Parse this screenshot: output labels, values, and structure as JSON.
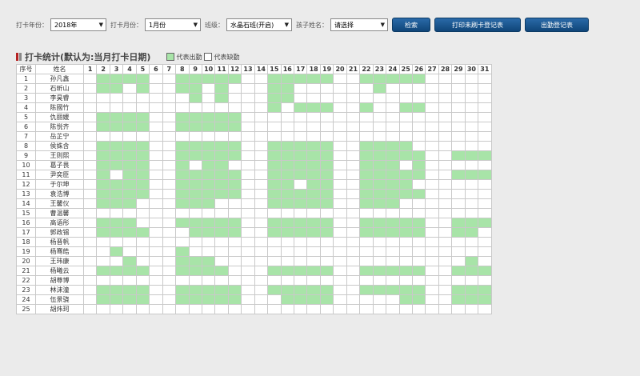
{
  "filters": {
    "year_label": "打卡年份：",
    "year_value": "2018年",
    "month_label": "打卡月份：",
    "month_value": "1月份",
    "class_label": "班级：",
    "class_value": "水晶石班(开启)",
    "child_label": "孩子姓名：",
    "child_value": "请选择"
  },
  "buttons": {
    "search": "检索",
    "print_unpunched": "打印未刷卡登记表",
    "attendance_sheet": "出勤登记表"
  },
  "section": {
    "title": "打卡统计(默认为:当月打卡日期)",
    "legend_present": "代表出勤",
    "legend_absent": "代表缺勤"
  },
  "colors": {
    "present": "#a8e4a8",
    "absent": "#ffffff",
    "button": "#1a5690",
    "title_mark": "#b52222"
  },
  "table": {
    "col_index": "序号",
    "col_name": "姓名",
    "days": [
      1,
      2,
      3,
      4,
      5,
      6,
      7,
      8,
      9,
      10,
      11,
      12,
      13,
      14,
      15,
      16,
      17,
      18,
      19,
      20,
      21,
      22,
      23,
      24,
      25,
      26,
      27,
      28,
      29,
      30,
      31
    ],
    "rows": [
      {
        "no": "1",
        "name": "孙凡鑫",
        "attend": [
          2,
          3,
          4,
          5,
          8,
          9,
          10,
          11,
          12,
          15,
          16,
          17,
          18,
          19,
          22,
          23,
          24,
          25,
          26
        ]
      },
      {
        "no": "2",
        "name": "石昕山",
        "attend": [
          2,
          3,
          5,
          8,
          9,
          11,
          15,
          16,
          23
        ]
      },
      {
        "no": "3",
        "name": "李昊睿",
        "attend": [
          9,
          11,
          15,
          16
        ]
      },
      {
        "no": "4",
        "name": "陈國竹",
        "attend": [
          15,
          17,
          18,
          19,
          22,
          25,
          26
        ]
      },
      {
        "no": "5",
        "name": "仇丽媛",
        "attend": [
          2,
          3,
          4,
          5,
          8,
          9,
          10,
          11,
          12
        ]
      },
      {
        "no": "6",
        "name": "陈悦齐",
        "attend": [
          2,
          3,
          4,
          5,
          8,
          9,
          10,
          11,
          12
        ]
      },
      {
        "no": "7",
        "name": "岳芷宁",
        "attend": []
      },
      {
        "no": "8",
        "name": "侯姝含",
        "attend": [
          2,
          3,
          4,
          5,
          8,
          9,
          10,
          11,
          12,
          15,
          16,
          17,
          18,
          19,
          22,
          23,
          24,
          25
        ]
      },
      {
        "no": "9",
        "name": "王则熙",
        "attend": [
          2,
          3,
          4,
          5,
          8,
          9,
          10,
          11,
          12,
          15,
          16,
          17,
          18,
          19,
          22,
          23,
          24,
          25,
          26,
          29,
          30,
          31
        ]
      },
      {
        "no": "10",
        "name": "葛子畏",
        "attend": [
          2,
          3,
          4,
          5,
          8,
          10,
          11,
          15,
          16,
          17,
          18,
          19,
          22,
          23,
          24,
          26
        ]
      },
      {
        "no": "11",
        "name": "尹奕臣",
        "attend": [
          2,
          4,
          5,
          8,
          9,
          10,
          11,
          12,
          15,
          16,
          17,
          18,
          19,
          22,
          23,
          24,
          25,
          26,
          29,
          30,
          31
        ]
      },
      {
        "no": "12",
        "name": "于尔坤",
        "attend": [
          2,
          3,
          4,
          5,
          8,
          9,
          10,
          11,
          12,
          15,
          16,
          18,
          19,
          22,
          23,
          24,
          25
        ]
      },
      {
        "no": "13",
        "name": "袁浩博",
        "attend": [
          2,
          3,
          4,
          5,
          8,
          9,
          10,
          11,
          12,
          15,
          16,
          17,
          18,
          19,
          22,
          23,
          24,
          25,
          26
        ]
      },
      {
        "no": "14",
        "name": "王馨仪",
        "attend": [
          2,
          3,
          4,
          8,
          9,
          10,
          15,
          16,
          17,
          18,
          19,
          22,
          23,
          24
        ]
      },
      {
        "no": "15",
        "name": "曹温馨",
        "attend": []
      },
      {
        "no": "16",
        "name": "高语彤",
        "attend": [
          2,
          3,
          4,
          8,
          9,
          10,
          11,
          12,
          15,
          16,
          17,
          18,
          19,
          22,
          23,
          24,
          25,
          26,
          29,
          30,
          31
        ]
      },
      {
        "no": "17",
        "name": "郭政锡",
        "attend": [
          2,
          3,
          4,
          5,
          9,
          10,
          11,
          12,
          15,
          16,
          17,
          18,
          19,
          22,
          23,
          24,
          25,
          26,
          29,
          30
        ]
      },
      {
        "no": "18",
        "name": "杨晋帆",
        "attend": []
      },
      {
        "no": "19",
        "name": "杨骞皓",
        "attend": [
          3,
          8
        ]
      },
      {
        "no": "20",
        "name": "王玮康",
        "attend": [
          4,
          8,
          9,
          10,
          30
        ]
      },
      {
        "no": "21",
        "name": "杨曦云",
        "attend": [
          2,
          3,
          4,
          5,
          8,
          9,
          10,
          11,
          15,
          16,
          17,
          18,
          19,
          22,
          23,
          24,
          25,
          26,
          29,
          30,
          31
        ]
      },
      {
        "no": "22",
        "name": "胡尊博",
        "attend": []
      },
      {
        "no": "23",
        "name": "林沫潼",
        "attend": [
          2,
          3,
          4,
          5,
          8,
          9,
          10,
          11,
          12,
          15,
          16,
          17,
          18,
          19,
          22,
          23,
          24,
          25,
          26,
          29,
          30,
          31
        ]
      },
      {
        "no": "24",
        "name": "伍景骁",
        "attend": [
          2,
          3,
          4,
          5,
          8,
          9,
          10,
          11,
          12,
          16,
          17,
          18,
          19,
          25,
          26,
          29,
          30,
          31
        ]
      },
      {
        "no": "25",
        "name": "胡炜珂",
        "attend": []
      }
    ]
  }
}
